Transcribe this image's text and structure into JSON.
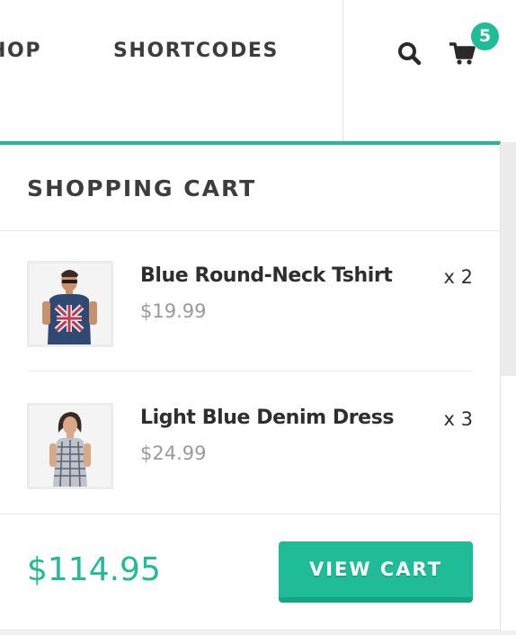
{
  "nav": {
    "items": [
      {
        "label": "HOP"
      },
      {
        "label": "SHORTCODES"
      }
    ],
    "search_icon": "search-icon",
    "cart_icon": "shopping-cart-icon",
    "cart_count": "5"
  },
  "cart": {
    "title": "SHOPPING CART",
    "items": [
      {
        "name": "Blue Round-Neck Tshirt",
        "price": "$19.99",
        "qty": "x 2"
      },
      {
        "name": "Light Blue Denim Dress",
        "price": "$24.99",
        "qty": "x 3"
      }
    ],
    "total": "$114.95",
    "view_cart_label": "VIEW CART"
  },
  "colors": {
    "accent": "#1fbc97",
    "text_dark": "#2e2e2e",
    "text_muted": "#9a9a9a"
  }
}
